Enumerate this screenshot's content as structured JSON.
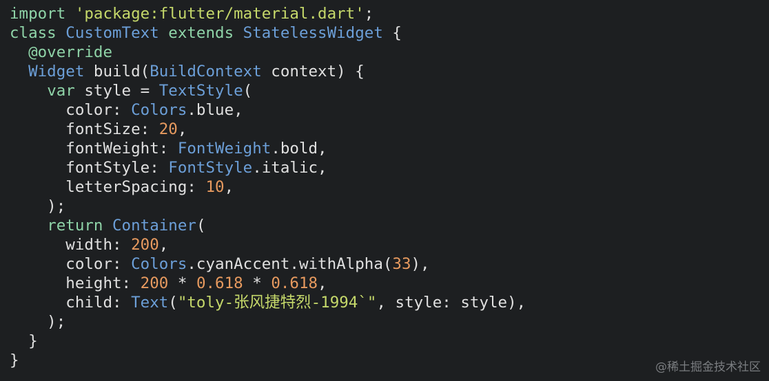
{
  "colors": {
    "background": "#1d1f21",
    "keyword": "#8fd4a8",
    "type": "#6c9fd8",
    "string": "#c5d86a",
    "number": "#e79a5f",
    "plain": "#e0e0e0"
  },
  "code_lines": [
    [
      {
        "t": "import",
        "c": "k"
      },
      {
        "t": " ",
        "c": "p"
      },
      {
        "t": "'package:flutter/material.dart'",
        "c": "s"
      },
      {
        "t": ";",
        "c": "p"
      }
    ],
    [
      {
        "t": "class",
        "c": "k"
      },
      {
        "t": " ",
        "c": "p"
      },
      {
        "t": "CustomText",
        "c": "t"
      },
      {
        "t": " ",
        "c": "p"
      },
      {
        "t": "extends",
        "c": "k"
      },
      {
        "t": " ",
        "c": "p"
      },
      {
        "t": "StatelessWidget",
        "c": "t"
      },
      {
        "t": " {",
        "c": "p"
      }
    ],
    [
      {
        "t": "  ",
        "c": "p"
      },
      {
        "t": "@override",
        "c": "k"
      }
    ],
    [
      {
        "t": "  ",
        "c": "p"
      },
      {
        "t": "Widget",
        "c": "t"
      },
      {
        "t": " build(",
        "c": "p"
      },
      {
        "t": "BuildContext",
        "c": "t"
      },
      {
        "t": " context) {",
        "c": "p"
      }
    ],
    [
      {
        "t": "    ",
        "c": "p"
      },
      {
        "t": "var",
        "c": "k"
      },
      {
        "t": " style = ",
        "c": "p"
      },
      {
        "t": "TextStyle",
        "c": "t"
      },
      {
        "t": "(",
        "c": "p"
      }
    ],
    [
      {
        "t": "      color: ",
        "c": "p"
      },
      {
        "t": "Colors",
        "c": "t"
      },
      {
        "t": ".blue,",
        "c": "p"
      }
    ],
    [
      {
        "t": "      fontSize: ",
        "c": "p"
      },
      {
        "t": "20",
        "c": "n"
      },
      {
        "t": ",",
        "c": "p"
      }
    ],
    [
      {
        "t": "      fontWeight: ",
        "c": "p"
      },
      {
        "t": "FontWeight",
        "c": "t"
      },
      {
        "t": ".bold,",
        "c": "p"
      }
    ],
    [
      {
        "t": "      fontStyle: ",
        "c": "p"
      },
      {
        "t": "FontStyle",
        "c": "t"
      },
      {
        "t": ".italic,",
        "c": "p"
      }
    ],
    [
      {
        "t": "      letterSpacing: ",
        "c": "p"
      },
      {
        "t": "10",
        "c": "n"
      },
      {
        "t": ",",
        "c": "p"
      }
    ],
    [
      {
        "t": "    );",
        "c": "p"
      }
    ],
    [
      {
        "t": "    ",
        "c": "p"
      },
      {
        "t": "return",
        "c": "k"
      },
      {
        "t": " ",
        "c": "p"
      },
      {
        "t": "Container",
        "c": "t"
      },
      {
        "t": "(",
        "c": "p"
      }
    ],
    [
      {
        "t": "      width: ",
        "c": "p"
      },
      {
        "t": "200",
        "c": "n"
      },
      {
        "t": ",",
        "c": "p"
      }
    ],
    [
      {
        "t": "      color: ",
        "c": "p"
      },
      {
        "t": "Colors",
        "c": "t"
      },
      {
        "t": ".cyanAccent.withAlpha(",
        "c": "p"
      },
      {
        "t": "33",
        "c": "n"
      },
      {
        "t": "),",
        "c": "p"
      }
    ],
    [
      {
        "t": "      height: ",
        "c": "p"
      },
      {
        "t": "200",
        "c": "n"
      },
      {
        "t": " * ",
        "c": "p"
      },
      {
        "t": "0.618",
        "c": "n"
      },
      {
        "t": " * ",
        "c": "p"
      },
      {
        "t": "0.618",
        "c": "n"
      },
      {
        "t": ",",
        "c": "p"
      }
    ],
    [
      {
        "t": "      child: ",
        "c": "p"
      },
      {
        "t": "Text",
        "c": "t"
      },
      {
        "t": "(",
        "c": "p"
      },
      {
        "t": "\"toly-张风捷特烈-1994`\"",
        "c": "s"
      },
      {
        "t": ", style: style),",
        "c": "p"
      }
    ],
    [
      {
        "t": "    );",
        "c": "p"
      }
    ],
    [
      {
        "t": "  }",
        "c": "p"
      }
    ],
    [
      {
        "t": "}",
        "c": "p"
      }
    ]
  ],
  "watermark": "@稀土掘金技术社区"
}
